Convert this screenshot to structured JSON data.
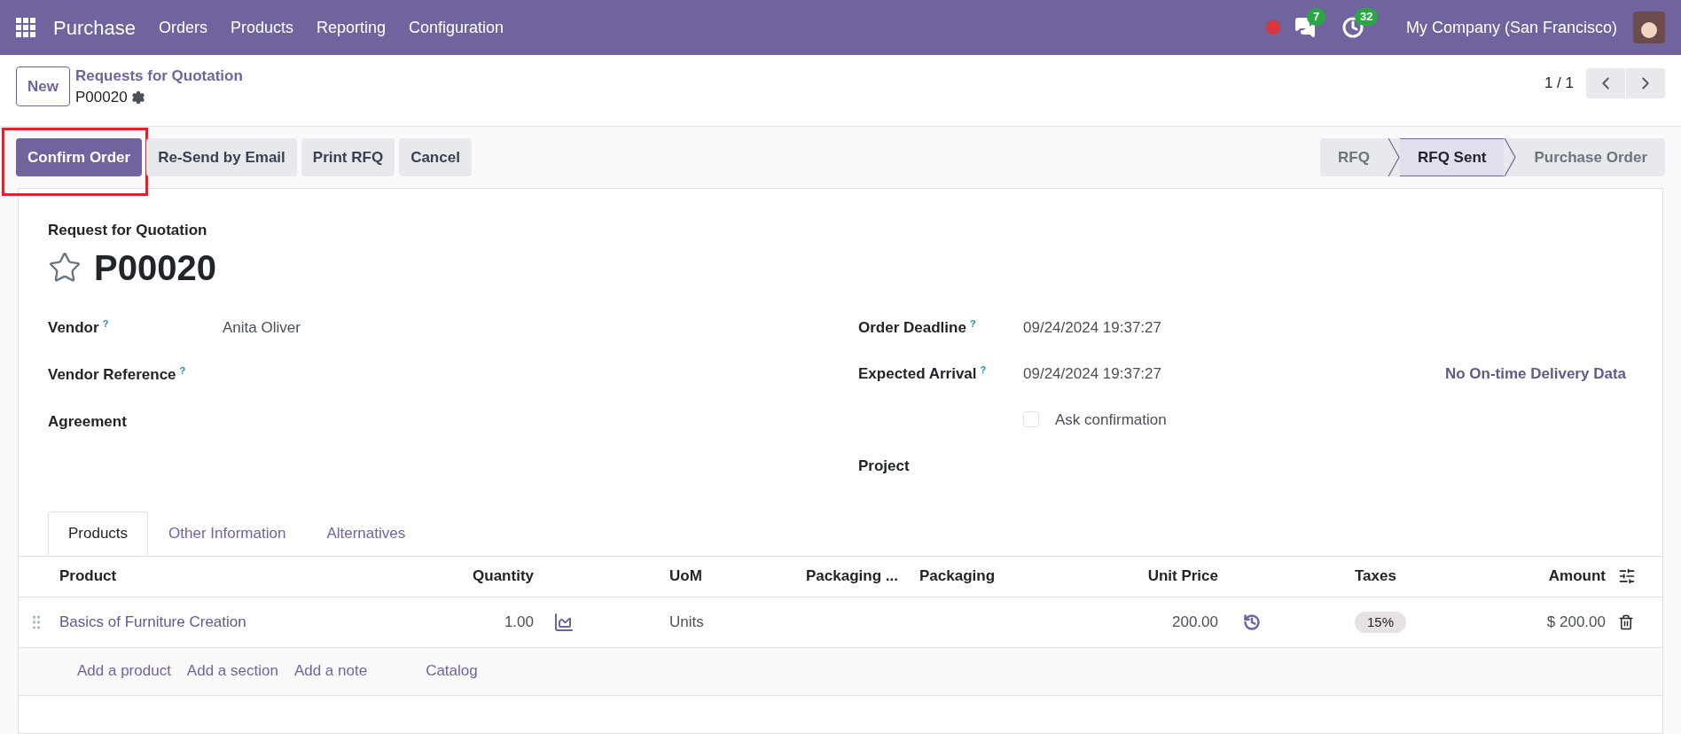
{
  "navbar": {
    "app_name": "Purchase",
    "menu": [
      "Orders",
      "Products",
      "Reporting",
      "Configuration"
    ],
    "messages_count": "7",
    "activities_count": "32",
    "company": "My Company (San Francisco)"
  },
  "breadcrumb": {
    "parent": "Requests for Quotation",
    "record": "P00020"
  },
  "new_button": "New",
  "pager": "1 / 1",
  "actions": [
    {
      "label": "Confirm Order",
      "kind": "primary",
      "highlighted": true
    },
    {
      "label": "Re-Send by Email",
      "kind": "secondary",
      "highlighted": false
    },
    {
      "label": "Print RFQ",
      "kind": "secondary",
      "highlighted": false
    },
    {
      "label": "Cancel",
      "kind": "secondary",
      "highlighted": false
    }
  ],
  "stages": [
    {
      "label": "RFQ",
      "selected": false
    },
    {
      "label": "RFQ Sent",
      "selected": true
    },
    {
      "label": "Purchase Order",
      "selected": false
    }
  ],
  "form": {
    "subtitle": "Request for Quotation",
    "title": "P00020",
    "starred": false,
    "left_fields": [
      {
        "label": "Vendor",
        "help": "?",
        "value": "Anita Oliver"
      },
      {
        "label": "Vendor Reference",
        "help": "?"
      },
      {
        "label": "Agreement"
      }
    ],
    "right_fields": [
      {
        "kind": "field",
        "label": "Order Deadline",
        "help": "?",
        "value": "09/24/2024 19:37:27"
      },
      {
        "kind": "field",
        "label": "Expected Arrival",
        "help": "?",
        "value": "09/24/2024 19:37:27",
        "aside": "No On-time Delivery Data"
      },
      {
        "kind": "checkbox",
        "label": "Ask confirmation",
        "checked": false
      },
      {
        "kind": "field",
        "label": "Project"
      }
    ]
  },
  "tabs": [
    {
      "label": "Products",
      "selected": true
    },
    {
      "label": "Other Information",
      "selected": false
    },
    {
      "label": "Alternatives",
      "selected": false
    }
  ],
  "table": {
    "columns": [
      "Product",
      "Quantity",
      "UoM",
      "Packaging ...",
      "Packaging",
      "Unit Price",
      "Taxes",
      "Amount"
    ],
    "rows": [
      {
        "product": "Basics of Furniture Creation",
        "quantity": "1.00",
        "uom": "Units",
        "unit_price": "200.00",
        "taxes": "15%",
        "amount": "$ 200.00"
      }
    ],
    "add_links": [
      "Add a product",
      "Add a section",
      "Add a note",
      "Catalog"
    ]
  }
}
